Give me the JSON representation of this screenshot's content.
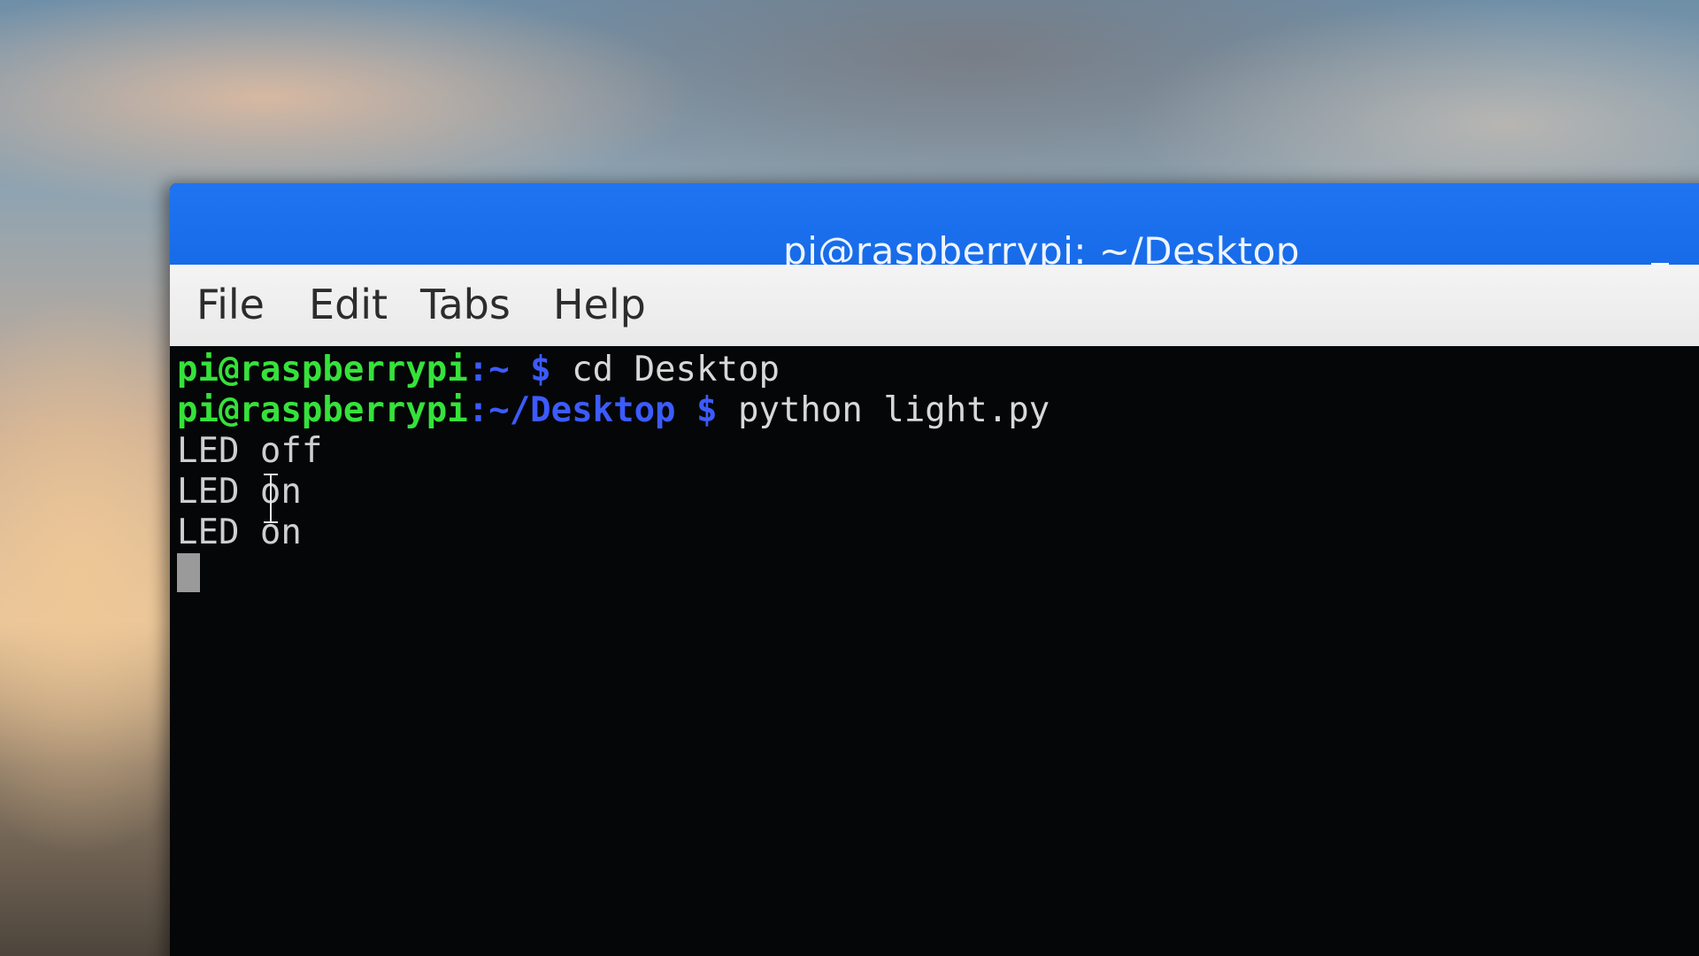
{
  "window": {
    "title": "pi@raspberrypi: ~/Desktop",
    "controls": [
      "minimize-icon",
      "maximize-icon"
    ]
  },
  "menu": {
    "file": "File",
    "edit": "Edit",
    "tabs": "Tabs",
    "help": "Help"
  },
  "terminal": {
    "lines": [
      {
        "user": "pi@raspberrypi",
        "path": ":~ $",
        "command": " cd Desktop"
      },
      {
        "user": "pi@raspberrypi",
        "path": ":~/Desktop $",
        "command": " python light.py"
      }
    ],
    "output": [
      "LED off",
      "LED on",
      "LED on"
    ]
  },
  "colors": {
    "title_bar": "#1f74f2",
    "prompt_user": "#35e23a",
    "prompt_path": "#3b5bff",
    "terminal_bg": "#050607"
  }
}
